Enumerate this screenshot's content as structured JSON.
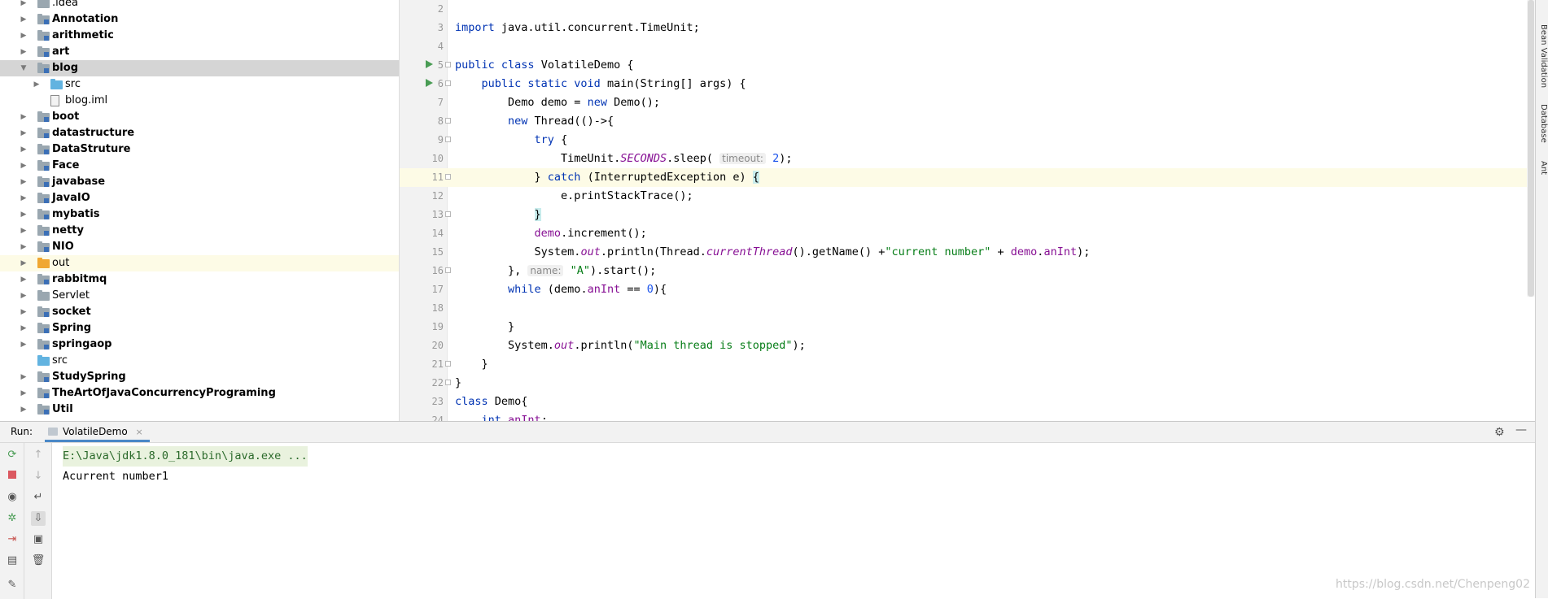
{
  "project_tree": {
    "items": [
      {
        "label": ".idea",
        "kind": "folder",
        "indent": 1,
        "expanded": false,
        "bold": false
      },
      {
        "label": "Annotation",
        "kind": "module",
        "indent": 1,
        "expanded": false,
        "bold": true
      },
      {
        "label": "arithmetic",
        "kind": "module",
        "indent": 1,
        "expanded": false,
        "bold": true
      },
      {
        "label": "art",
        "kind": "module",
        "indent": 1,
        "expanded": false,
        "bold": true
      },
      {
        "label": "blog",
        "kind": "module",
        "indent": 1,
        "expanded": true,
        "bold": true,
        "selected": true
      },
      {
        "label": "src",
        "kind": "src",
        "indent": 2,
        "expanded": false,
        "bold": false
      },
      {
        "label": "blog.iml",
        "kind": "file",
        "indent": 2,
        "bold": false
      },
      {
        "label": "boot",
        "kind": "module",
        "indent": 1,
        "expanded": false,
        "bold": true
      },
      {
        "label": "datastructure",
        "kind": "module",
        "indent": 1,
        "expanded": false,
        "bold": true
      },
      {
        "label": "DataStruture",
        "kind": "module",
        "indent": 1,
        "expanded": false,
        "bold": true
      },
      {
        "label": "Face",
        "kind": "module",
        "indent": 1,
        "expanded": false,
        "bold": true
      },
      {
        "label": "javabase",
        "kind": "module",
        "indent": 1,
        "expanded": false,
        "bold": true
      },
      {
        "label": "JavaIO",
        "kind": "module",
        "indent": 1,
        "expanded": false,
        "bold": true
      },
      {
        "label": "mybatis",
        "kind": "module",
        "indent": 1,
        "expanded": false,
        "bold": true
      },
      {
        "label": "netty",
        "kind": "module",
        "indent": 1,
        "expanded": false,
        "bold": true
      },
      {
        "label": "NIO",
        "kind": "module",
        "indent": 1,
        "expanded": false,
        "bold": true
      },
      {
        "label": "out",
        "kind": "out",
        "indent": 1,
        "expanded": false,
        "bold": false,
        "highlight": true
      },
      {
        "label": "rabbitmq",
        "kind": "module",
        "indent": 1,
        "expanded": false,
        "bold": true
      },
      {
        "label": "Servlet",
        "kind": "folder",
        "indent": 1,
        "expanded": false,
        "bold": false
      },
      {
        "label": "socket",
        "kind": "module",
        "indent": 1,
        "expanded": false,
        "bold": true
      },
      {
        "label": "Spring",
        "kind": "module",
        "indent": 1,
        "expanded": false,
        "bold": true
      },
      {
        "label": "springaop",
        "kind": "module",
        "indent": 1,
        "expanded": false,
        "bold": true
      },
      {
        "label": "src",
        "kind": "src",
        "indent": 1,
        "bold": false
      },
      {
        "label": "StudySpring",
        "kind": "module",
        "indent": 1,
        "expanded": false,
        "bold": true
      },
      {
        "label": "TheArtOfJavaConcurrencyPrograming",
        "kind": "module",
        "indent": 1,
        "expanded": false,
        "bold": true
      },
      {
        "label": "Util",
        "kind": "module",
        "indent": 1,
        "expanded": false,
        "bold": true
      }
    ]
  },
  "editor": {
    "current_line": 11,
    "lines": [
      {
        "num": "2",
        "tokens": []
      },
      {
        "num": "3",
        "tokens": [
          [
            "k",
            "import"
          ],
          [
            "",
            "java.util.concurrent.TimeUnit;"
          ]
        ]
      },
      {
        "num": "4",
        "tokens": []
      },
      {
        "num": "5",
        "run": true,
        "fold": true,
        "tokens": [
          [
            "k",
            "public class"
          ],
          [
            "",
            "VolatileDemo {"
          ]
        ]
      },
      {
        "num": "6",
        "run": true,
        "fold": true,
        "tokens": [
          [
            "",
            "    "
          ],
          [
            "k",
            "public static void"
          ],
          [
            "",
            "main(String[] args) {"
          ]
        ]
      },
      {
        "num": "7",
        "tokens": [
          [
            "",
            "        Demo demo = "
          ],
          [
            "k",
            "new"
          ],
          [
            "",
            " Demo();"
          ]
        ]
      },
      {
        "num": "8",
        "fold": true,
        "tokens": [
          [
            "",
            "        "
          ],
          [
            "k",
            "new"
          ],
          [
            "",
            " Thread(()->{"
          ]
        ]
      },
      {
        "num": "9",
        "fold": true,
        "tokens": [
          [
            "",
            "            "
          ],
          [
            "k",
            "try"
          ],
          [
            "",
            " {"
          ]
        ]
      },
      {
        "num": "10",
        "tokens": [
          [
            "",
            "                TimeUnit."
          ],
          [
            "fi",
            "SECONDS"
          ],
          [
            "",
            ".sleep( "
          ],
          [
            "hint",
            "timeout:"
          ],
          [
            "",
            ""
          ],
          [
            "n",
            " 2"
          ],
          [
            "",
            ");"
          ]
        ]
      },
      {
        "num": "11",
        "fold": true,
        "tokens": [
          [
            "",
            "            } "
          ],
          [
            "k",
            "catch"
          ],
          [
            "",
            " (InterruptedException e) "
          ],
          [
            "bh",
            "{"
          ]
        ]
      },
      {
        "num": "12",
        "tokens": [
          [
            "",
            "                e.printStackTrace();"
          ]
        ]
      },
      {
        "num": "13",
        "fold": true,
        "tokens": [
          [
            "",
            "            "
          ],
          [
            "bh",
            "}"
          ]
        ]
      },
      {
        "num": "14",
        "tokens": [
          [
            "",
            "            "
          ],
          [
            "f",
            "demo"
          ],
          [
            "",
            ".increment();"
          ]
        ]
      },
      {
        "num": "15",
        "tokens": [
          [
            "",
            "            System."
          ],
          [
            "fi",
            "out"
          ],
          [
            "",
            ".println(Thread."
          ],
          [
            "fi",
            "currentThread"
          ],
          [
            "",
            "().getName() +"
          ],
          [
            "s",
            "\"current number\""
          ],
          [
            "",
            " + "
          ],
          [
            "f",
            "demo"
          ],
          [
            "",
            "."
          ],
          [
            "f",
            "anInt"
          ],
          [
            "",
            ");"
          ]
        ]
      },
      {
        "num": "16",
        "fold": true,
        "tokens": [
          [
            "",
            "        }, "
          ],
          [
            "hint",
            "name:"
          ],
          [
            "",
            " "
          ],
          [
            "s",
            "\"A\""
          ],
          [
            "",
            ").start();"
          ]
        ]
      },
      {
        "num": "17",
        "tokens": [
          [
            "",
            "        "
          ],
          [
            "k",
            "while"
          ],
          [
            "",
            " (demo."
          ],
          [
            "f",
            "anInt"
          ],
          [
            "",
            " == "
          ],
          [
            "n",
            "0"
          ],
          [
            "",
            "){"
          ]
        ]
      },
      {
        "num": "18",
        "tokens": []
      },
      {
        "num": "19",
        "tokens": [
          [
            "",
            "        }"
          ]
        ]
      },
      {
        "num": "20",
        "tokens": [
          [
            "",
            "        System."
          ],
          [
            "fi",
            "out"
          ],
          [
            "",
            ".println("
          ],
          [
            "s",
            "\"Main thread is stopped\""
          ],
          [
            "",
            ");"
          ]
        ]
      },
      {
        "num": "21",
        "fold": true,
        "tokens": [
          [
            "",
            "    }"
          ]
        ]
      },
      {
        "num": "22",
        "fold": true,
        "tokens": [
          [
            "",
            "}"
          ]
        ]
      },
      {
        "num": "23",
        "tokens": [
          [
            "k",
            "class"
          ],
          [
            "",
            " Demo{"
          ]
        ]
      },
      {
        "num": "24",
        "tokens": [
          [
            "",
            "    "
          ],
          [
            "k",
            "int"
          ],
          [
            "",
            " "
          ],
          [
            "f",
            "anInt"
          ],
          [
            "",
            ";"
          ]
        ]
      }
    ]
  },
  "right_tools": {
    "tabs": [
      "Bean Validation",
      "Database",
      "Ant"
    ]
  },
  "run_panel": {
    "label": "Run:",
    "tab_title": "VolatileDemo",
    "tab_close": "×",
    "console": {
      "command": "E:\\Java\\jdk1.8.0_181\\bin\\java.exe ...",
      "output": "Acurrent number1"
    }
  },
  "watermark": "https://blog.csdn.net/Chenpeng02",
  "colors": {
    "keyword": "#0033b3",
    "field": "#871094",
    "string": "#067d17",
    "number": "#1750eb",
    "run_green": "#499c54",
    "selection": "#d5d5d5",
    "current_line": "#fdfbe6",
    "tab_underline": "#4a88c7"
  }
}
